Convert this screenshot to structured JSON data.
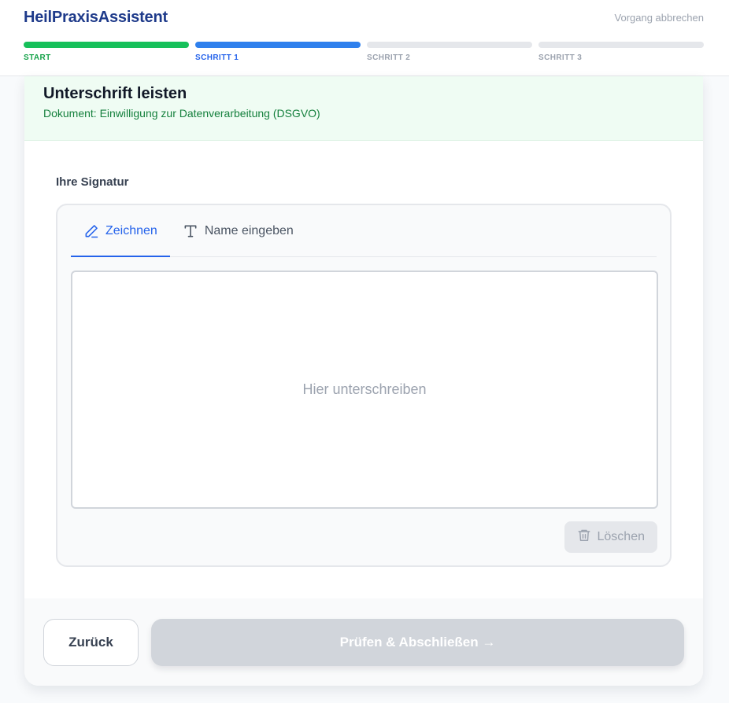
{
  "app": {
    "title": "HeilPraxisAssistent",
    "cancel_label": "Vorgang abbrechen"
  },
  "steps": [
    {
      "label": "START",
      "state": "done"
    },
    {
      "label": "SCHRITT 1",
      "state": "active"
    },
    {
      "label": "SCHRITT 2",
      "state": "pending"
    },
    {
      "label": "SCHRITT 3",
      "state": "pending"
    }
  ],
  "header": {
    "title": "Unterschrift leisten",
    "subtitle": "Dokument: Einwilligung zur Datenverarbeitung (DSGVO)"
  },
  "signature": {
    "label": "Ihre Signatur",
    "tabs": [
      {
        "label": "Zeichnen",
        "icon": "pen-icon",
        "active": true
      },
      {
        "label": "Name eingeben",
        "icon": "text-icon",
        "active": false
      }
    ],
    "canvas_hint": "Hier unterschreiben",
    "clear_label": "Löschen",
    "clear_icon": "trash-icon"
  },
  "footer": {
    "back_label": "Zurück",
    "finish_label": "Prüfen & Abschließen →"
  },
  "colors": {
    "brand": "#1e3a8a",
    "step_done": "#16c05a",
    "step_active": "#2f80ed",
    "step_pending": "#e5e7eb",
    "header_bg": "#effcf3",
    "subtitle": "#15803d",
    "tab_active": "#2563eb",
    "disabled": "#d1d5db"
  }
}
